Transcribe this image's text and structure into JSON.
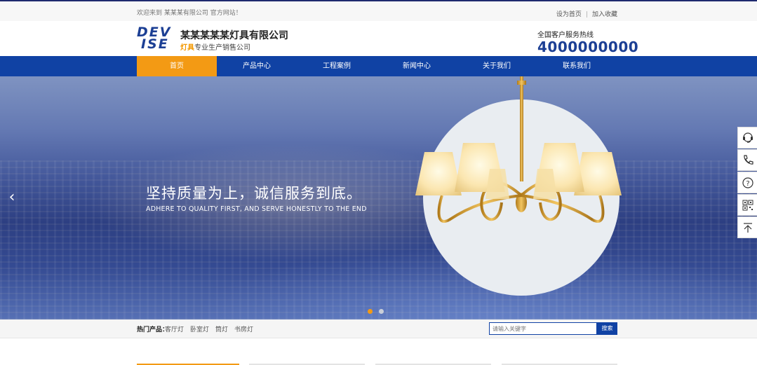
{
  "topbar": {
    "welcome": "欢迎来到 某某某有限公司 官方网站！",
    "set_home": "设为首页",
    "separator": "|",
    "add_favorite": "加入收藏"
  },
  "header": {
    "logo_line1": "DEV",
    "logo_line2": "ISE",
    "company_name": "某某某某某灯具有限公司",
    "tagline_highlight": "灯具",
    "tagline_rest": "专业生产销售公司",
    "hotline_label": "全国客户服务热线",
    "hotline_number": "4000000000"
  },
  "nav": {
    "items": [
      {
        "label": "首页",
        "active": true
      },
      {
        "label": "产品中心",
        "active": false
      },
      {
        "label": "工程案例",
        "active": false
      },
      {
        "label": "新闻中心",
        "active": false
      },
      {
        "label": "关于我们",
        "active": false
      },
      {
        "label": "联系我们",
        "active": false
      }
    ]
  },
  "banner": {
    "slogan_cn": "坚持质量为上，诚信服务到底。",
    "slogan_en": "ADHERE TO QUALITY FIRST, AND SERVE HONESTLY TO THE END",
    "prev_arrow": "‹",
    "dots_active": 1,
    "dots_total": 2
  },
  "float_icons": [
    "customer-service-icon",
    "phone-icon",
    "question-icon",
    "qrcode-icon",
    "back-to-top-icon"
  ],
  "hotbar": {
    "title": "热门产品：",
    "items": [
      "客厅灯",
      "卧室灯",
      "筒灯",
      "书房灯"
    ],
    "search_placeholder": "请输入关键字",
    "search_button": "搜索"
  },
  "colors": {
    "brand_blue": "#1042a4",
    "accent_orange": "#f39a14",
    "dark_blue": "#1c3f94"
  }
}
